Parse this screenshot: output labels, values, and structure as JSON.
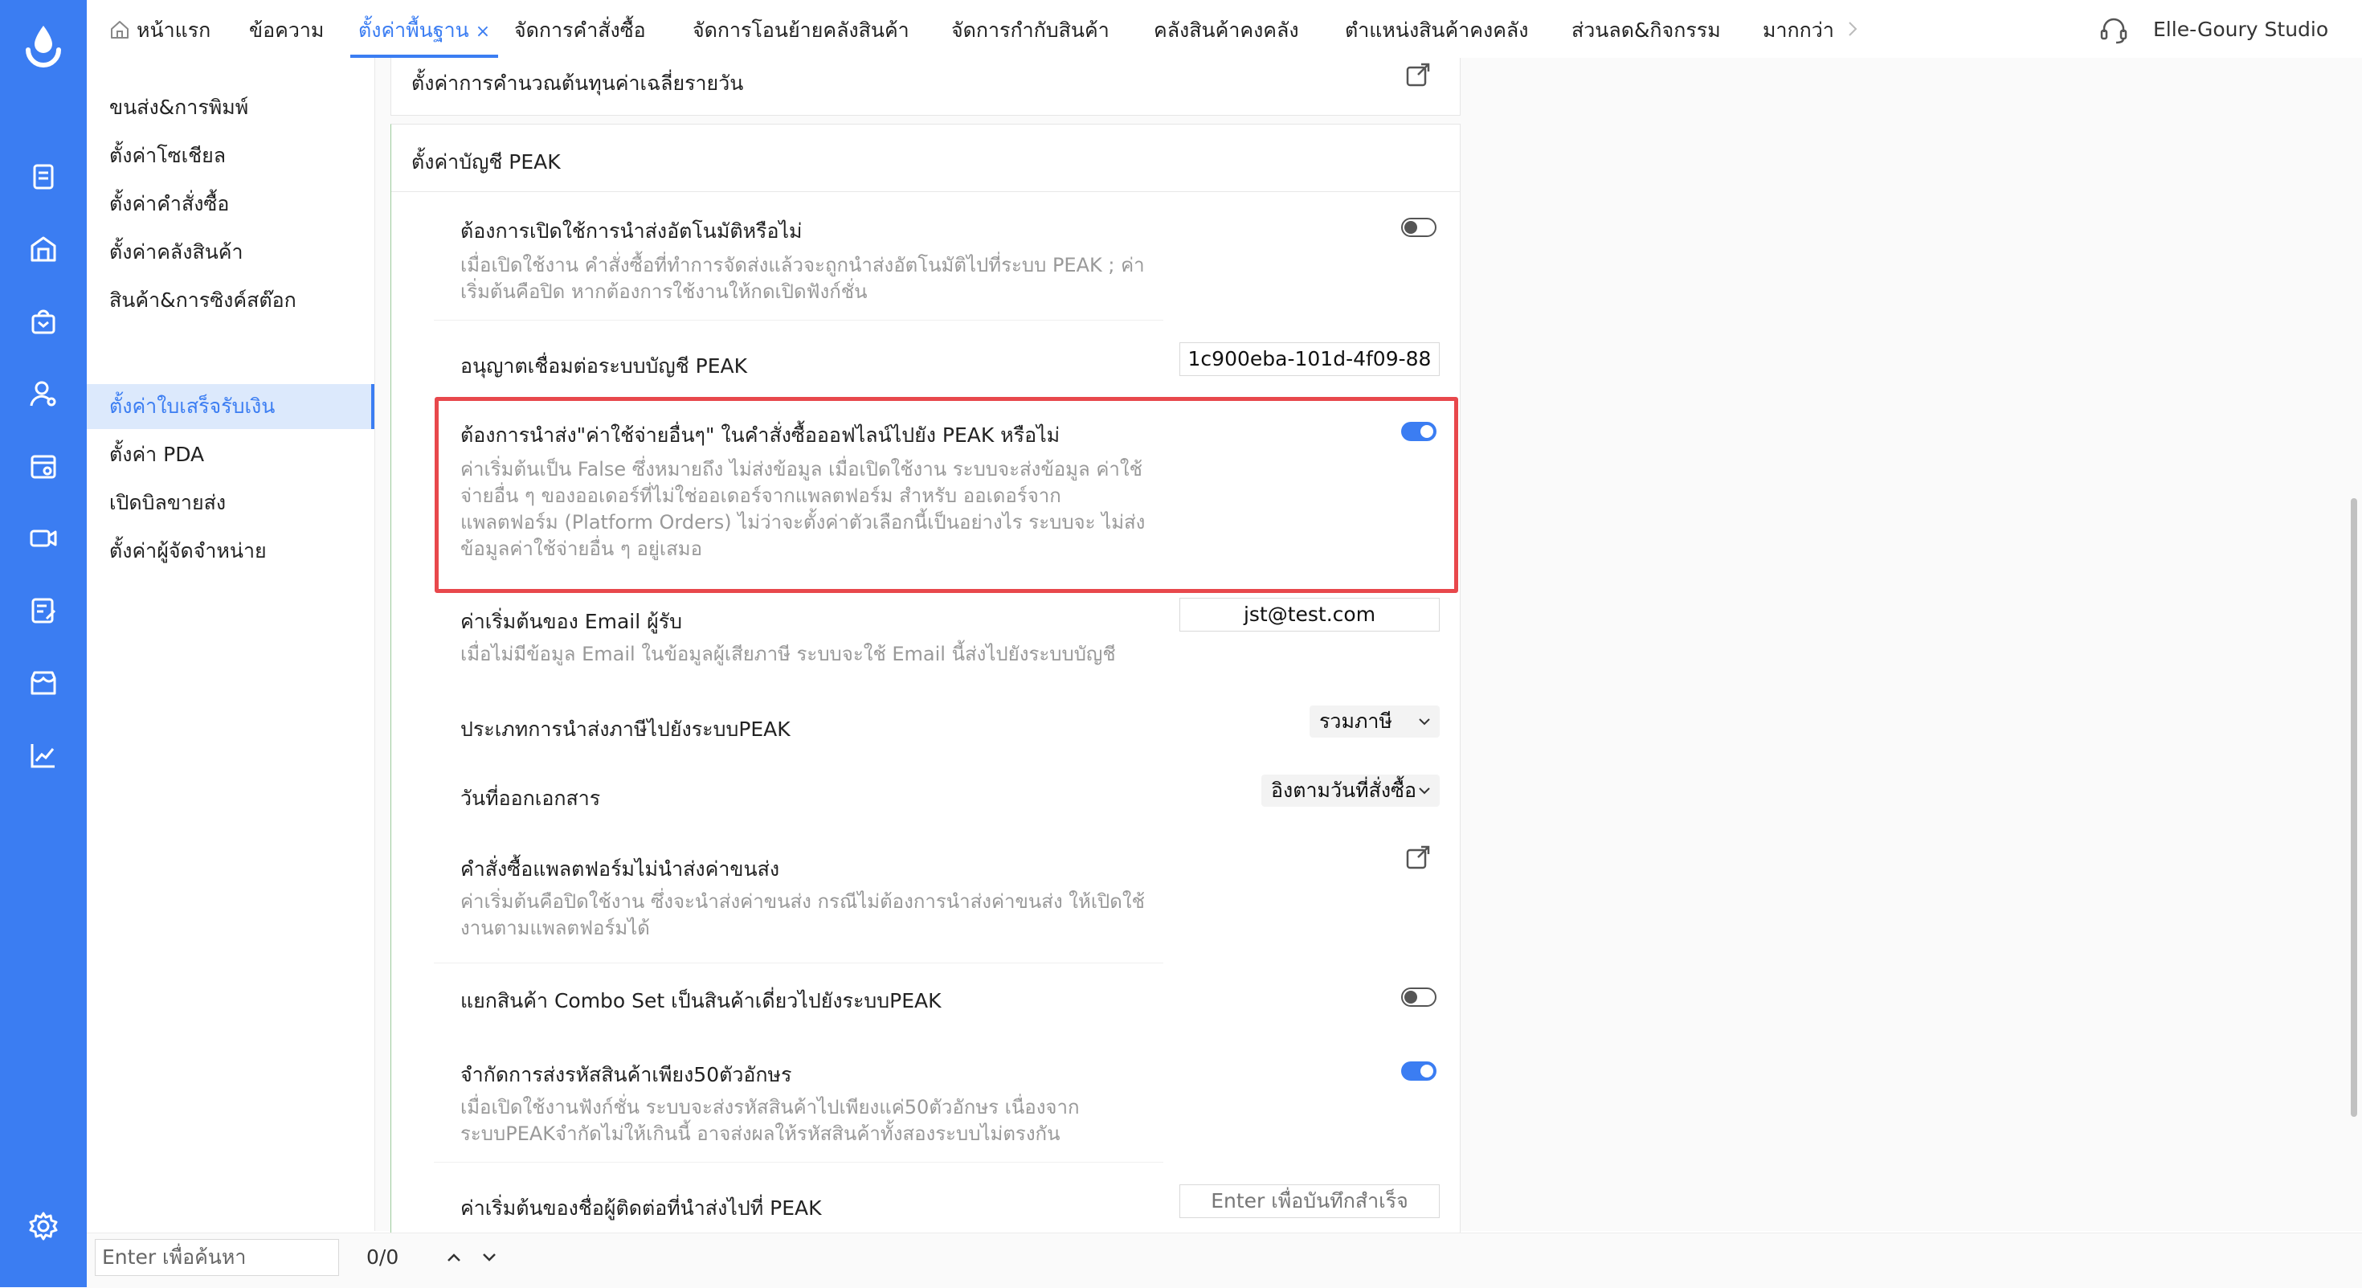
{
  "brand": {
    "accent": "#3b7df2",
    "highlight": "#e8484c"
  },
  "topnav": {
    "tabs": [
      {
        "label": "หน้าแรก"
      },
      {
        "label": "ข้อความ"
      },
      {
        "label": "ตั้งค่าพื้นฐาน",
        "active": true
      },
      {
        "label": "จัดการคำสั่งซื้อ"
      },
      {
        "label": "จัดการโอนย้ายคลังสินค้า"
      },
      {
        "label": "จัดการกำกับสินค้า"
      },
      {
        "label": "คลังสินค้าคงคลัง"
      },
      {
        "label": "ตำแหน่งสินค้าคงคลัง"
      },
      {
        "label": "ส่วนลด&กิจกรรม"
      },
      {
        "label": "มากกว่า"
      }
    ],
    "close_symbol": "×",
    "studio_name": "Elle-Goury Studio"
  },
  "sidemenu": {
    "items": [
      {
        "label": "ขนส่ง&การพิมพ์"
      },
      {
        "label": "ตั้งค่าโซเชียล"
      },
      {
        "label": "ตั้งค่าคำสั่งซื้อ"
      },
      {
        "label": "ตั้งค่าคลังสินค้า"
      },
      {
        "label": "สินค้า&การซิงค์สต๊อก"
      },
      {
        "label": "ตั้งค่าใบเสร็จรับเงิน",
        "active": true
      },
      {
        "label": "ตั้งค่า PDA"
      },
      {
        "label": "เปิดบิลขายส่ง"
      },
      {
        "label": "ตั้งค่าผู้จัดจำหน่าย"
      }
    ]
  },
  "rail_icons": [
    "logo-drop-icon",
    "document-icon",
    "warehouse-icon",
    "shopping-bag-icon",
    "user-settings-icon",
    "store-settings-icon",
    "video-icon",
    "edit-list-icon",
    "shop-icon",
    "chart-icon",
    "settings-gear-icon"
  ],
  "cost_section": {
    "title": "ตั้งค่าการคำนวณต้นทุนค่าเฉลี่ยรายวัน"
  },
  "peak_section": {
    "title": "ตั้งค่าบัญชี PEAK",
    "settings": {
      "auto_push": {
        "title": "ต้องการเปิดใช้การนำส่งอัตโนมัติหรือไม่",
        "desc": "เมื่อเปิดใช้งาน คำสั่งซื้อที่ทำการจัดส่งแล้วจะถูกนำส่งอัตโนมัติไปที่ระบบ PEAK ; ค่าเริ่มต้นคือปิด หากต้องการใช้งานให้กดเปิดฟังก์ชั่น",
        "enabled": false
      },
      "authorize": {
        "title": "อนุญาตเชื่อมต่อระบบบัญชี PEAK",
        "value": "1c900eba-101d-4f09-88"
      },
      "other_expenses": {
        "title": "ต้องการนำส่ง\"ค่าใช้จ่ายอื่นๆ\" ในคำสั่งซื้อออฟไลน์ไปยัง PEAK หรือไม่",
        "desc": "ค่าเริ่มต้นเป็น False ซึ่งหมายถึง ไม่ส่งข้อมูล เมื่อเปิดใช้งาน ระบบจะส่งข้อมูล ค่าใช้จ่ายอื่น ๆ ของออเดอร์ที่ไม่ใช่ออเดอร์จากแพลตฟอร์ม สำหรับ ออเดอร์จากแพลตฟอร์ม (Platform Orders) ไม่ว่าจะตั้งค่าตัวเลือกนี้เป็นอย่างไร ระบบจะ ไม่ส่งข้อมูลค่าใช้จ่ายอื่น ๆ อยู่เสมอ",
        "enabled": true
      },
      "default_email": {
        "title": "ค่าเริ่มต้นของ Email ผู้รับ",
        "desc": "เมื่อไม่มีข้อมูล Email ในข้อมูลผู้เสียภาษี ระบบจะใช้ Email นี้ส่งไปยังระบบบัญชี",
        "value": "jst@test.com"
      },
      "tax_type": {
        "title": "ประเภทการนำส่งภาษีไปยังระบบPEAK",
        "selected": "รวมภาษี"
      },
      "doc_date": {
        "title": "วันที่ออกเอกสาร",
        "selected": "อิงตามวันที่สั่งซื้อ"
      },
      "platform_shipping": {
        "title": "คำสั่งซื้อแพลตฟอร์มไม่นำส่งค่าขนส่ง",
        "desc": "ค่าเริ่มต้นคือปิดใช้งาน ซึ่งจะนำส่งค่าขนส่ง กรณีไม่ต้องการนำส่งค่าขนส่ง ให้เปิดใช้งานตามแพลตฟอร์มได้"
      },
      "combo_split": {
        "title": "แยกสินค้า Combo Set เป็นสินค้าเดี่ยวไปยังระบบPEAK",
        "enabled": false
      },
      "sku_limit": {
        "title": "จำกัดการส่งรหัสสินค้าเพียง50ตัวอักษร",
        "desc": "เมื่อเปิดใช้งานฟังก์ชั่น ระบบจะส่งรหัสสินค้าไปเพียงแค่50ตัวอักษร เนื่องจากระบบPEAKจำกัดไม่ให้เกินนี้ อาจส่งผลให้รหัสสินค้าทั้งสองระบบไม่ตรงกัน",
        "enabled": true
      },
      "default_contact": {
        "title": "ค่าเริ่มต้นของชื่อผู้ติดต่อที่นำส่งไปที่ PEAK",
        "placeholder": "Enter เพื่อบันทึกสำเร็จ"
      }
    }
  },
  "bottom": {
    "search_placeholder": "Enter เพื่อค้นหา",
    "count": "0/0"
  }
}
